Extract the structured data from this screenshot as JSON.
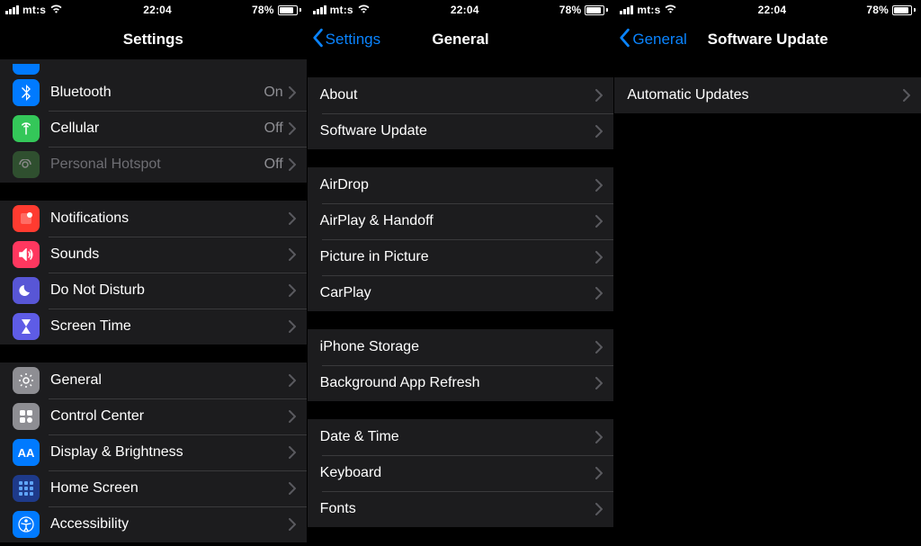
{
  "status": {
    "carrier": "mt:s",
    "time": "22:04",
    "battery_pct": "78%"
  },
  "pane1": {
    "title": "Settings",
    "rows": {
      "bluetooth": {
        "label": "Bluetooth",
        "value": "On"
      },
      "cellular": {
        "label": "Cellular",
        "value": "Off"
      },
      "hotspot": {
        "label": "Personal Hotspot",
        "value": "Off"
      },
      "notifications": {
        "label": "Notifications"
      },
      "sounds": {
        "label": "Sounds"
      },
      "dnd": {
        "label": "Do Not Disturb"
      },
      "screentime": {
        "label": "Screen Time"
      },
      "general": {
        "label": "General"
      },
      "controlcenter": {
        "label": "Control Center"
      },
      "display": {
        "label": "Display & Brightness"
      },
      "homescreen": {
        "label": "Home Screen"
      },
      "accessibility": {
        "label": "Accessibility"
      }
    }
  },
  "pane2": {
    "back": "Settings",
    "title": "General",
    "rows": {
      "about": "About",
      "software_update": "Software Update",
      "airdrop": "AirDrop",
      "airplay": "AirPlay & Handoff",
      "pip": "Picture in Picture",
      "carplay": "CarPlay",
      "storage": "iPhone Storage",
      "bg_refresh": "Background App Refresh",
      "datetime": "Date & Time",
      "keyboard": "Keyboard",
      "fonts": "Fonts"
    }
  },
  "pane3": {
    "back": "General",
    "title": "Software Update",
    "rows": {
      "auto_updates": "Automatic Updates"
    }
  }
}
